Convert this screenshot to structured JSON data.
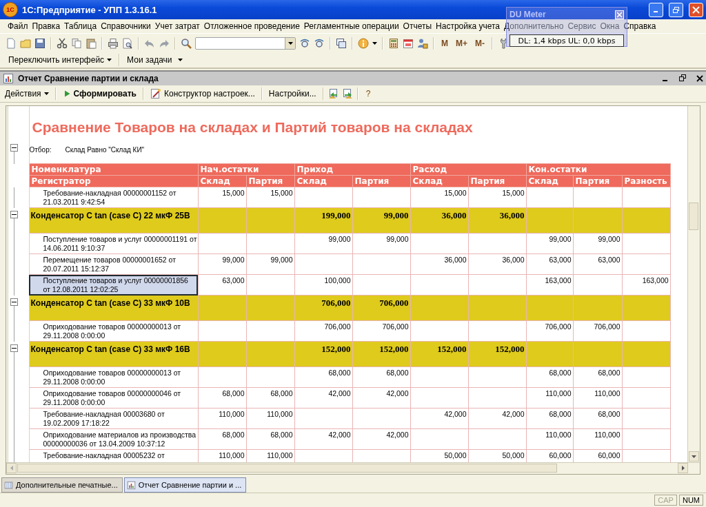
{
  "window": {
    "logo": "1С",
    "title": "1С:Предприятие  - УПП 1.3.16.1"
  },
  "menu": [
    "Файл",
    "Правка",
    "Таблица",
    "Справочники",
    "Учет затрат",
    "Отложенное проведение",
    "Регламентные операции",
    "Отчеты",
    "Настройка учета",
    "Дополнительно",
    "Сервис",
    "Окна",
    "Справка"
  ],
  "toolbar": {
    "memory_buttons": [
      "M",
      "M+",
      "M-"
    ]
  },
  "toolbar2": [
    "Переключить интерфейс",
    "Мои задачи"
  ],
  "du_meter": {
    "title": "DU Meter",
    "reading": "DL: 1,4 kbps  UL: 0,0 kbps"
  },
  "report_window": {
    "title": "Отчет  Сравнение партии и склада",
    "actions": {
      "menu": "Действия",
      "run": "Сформировать",
      "designer": "Конструктор настроек...",
      "settings": "Настройки...",
      "help": "?"
    },
    "report": {
      "title": "Сравнение Товаров на складах и Партий товаров на складах",
      "filter_label": "Отбор:",
      "filter_value": "Склад Равно \"Склад КИ\"",
      "header_top": [
        "Номенклатура",
        "Нач.остатки",
        "Приход",
        "Расход",
        "Кон.остатки"
      ],
      "header_sub": [
        "Регистратор",
        "Склад",
        "Партия",
        "Склад",
        "Партия",
        "Склад",
        "Партия",
        "Склад",
        "Партия",
        "Разность"
      ],
      "rows": [
        {
          "kind": "detail",
          "selected": false,
          "name": "Требование-накладная 00000001152 от 21.03.2011 9:42:54",
          "values": {
            "start_stock": "15,000",
            "start_batch": "15,000",
            "issue_stock": "15,000",
            "issue_batch": "15,000"
          }
        },
        {
          "kind": "group",
          "expanded": true,
          "selected": false,
          "name": "Конденсатор C tan (case C) 22 мкФ 25В",
          "values": {
            "receipt_stock": "199,000",
            "receipt_batch": "99,000",
            "issue_stock": "36,000",
            "issue_batch": "36,000"
          }
        },
        {
          "kind": "detail",
          "selected": false,
          "name": "Поступление товаров и услуг 00000001191 от 14.06.2011 9:10:37",
          "values": {
            "receipt_stock": "99,000",
            "receipt_batch": "99,000",
            "end_stock": "99,000",
            "end_batch": "99,000"
          }
        },
        {
          "kind": "detail",
          "selected": false,
          "name": "Перемещение товаров 00000001652 от 20.07.2011 15:12:37",
          "values": {
            "start_stock": "99,000",
            "start_batch": "99,000",
            "issue_stock": "36,000",
            "issue_batch": "36,000",
            "end_stock": "63,000",
            "end_batch": "63,000"
          }
        },
        {
          "kind": "detail",
          "selected": true,
          "name": "Поступление товаров и услуг 00000001856 от 12.08.2011 12:02:25",
          "values": {
            "start_stock": "63,000",
            "receipt_stock": "100,000",
            "end_stock": "163,000",
            "difference": "163,000"
          }
        },
        {
          "kind": "group",
          "expanded": true,
          "selected": false,
          "name": "Конденсатор C tan (case C) 33 мкФ 10В",
          "values": {
            "receipt_stock": "706,000",
            "receipt_batch": "706,000"
          }
        },
        {
          "kind": "detail",
          "selected": false,
          "name": "Оприходование товаров 00000000013 от 29.11.2008 0:00:00",
          "values": {
            "receipt_stock": "706,000",
            "receipt_batch": "706,000",
            "end_stock": "706,000",
            "end_batch": "706,000"
          }
        },
        {
          "kind": "group",
          "expanded": true,
          "selected": false,
          "name": "Конденсатор C tan (case C) 33 мкФ 16В",
          "values": {
            "receipt_stock": "152,000",
            "receipt_batch": "152,000",
            "issue_stock": "152,000",
            "issue_batch": "152,000"
          }
        },
        {
          "kind": "detail",
          "selected": false,
          "name": "Оприходование товаров 00000000013 от 29.11.2008 0:00:00",
          "values": {
            "receipt_stock": "68,000",
            "receipt_batch": "68,000",
            "end_stock": "68,000",
            "end_batch": "68,000"
          }
        },
        {
          "kind": "detail",
          "selected": false,
          "name": "Оприходование товаров 00000000046 от 29.11.2008 0:00:00",
          "values": {
            "start_stock": "68,000",
            "start_batch": "68,000",
            "receipt_stock": "42,000",
            "receipt_batch": "42,000",
            "end_stock": "110,000",
            "end_batch": "110,000"
          }
        },
        {
          "kind": "detail",
          "selected": false,
          "name": "Требование-накладная 00003680 от 19.02.2009 17:18:22",
          "values": {
            "start_stock": "110,000",
            "start_batch": "110,000",
            "issue_stock": "42,000",
            "issue_batch": "42,000",
            "end_stock": "68,000",
            "end_batch": "68,000"
          }
        },
        {
          "kind": "detail",
          "selected": false,
          "name": "Оприходование материалов из производства 00000000036 от 13.04.2009 10:37:12",
          "values": {
            "start_stock": "68,000",
            "start_batch": "68,000",
            "receipt_stock": "42,000",
            "receipt_batch": "42,000",
            "end_stock": "110,000",
            "end_batch": "110,000"
          }
        },
        {
          "kind": "detail",
          "selected": false,
          "name": "Требование-накладная 00005232 от",
          "values": {
            "start_stock": "110,000",
            "start_batch": "110,000",
            "issue_stock": "50,000",
            "issue_batch": "50,000",
            "end_stock": "60,000",
            "end_batch": "60,000"
          }
        }
      ]
    }
  },
  "window_tabs": [
    {
      "label": "Дополнительные печатные...",
      "selected": false
    },
    {
      "label": "Отчет  Сравнение партии и ...",
      "selected": true
    }
  ],
  "status_bar": {
    "indicators": [
      {
        "label": "CAP",
        "on": false
      },
      {
        "label": "NUM",
        "on": true
      }
    ]
  }
}
